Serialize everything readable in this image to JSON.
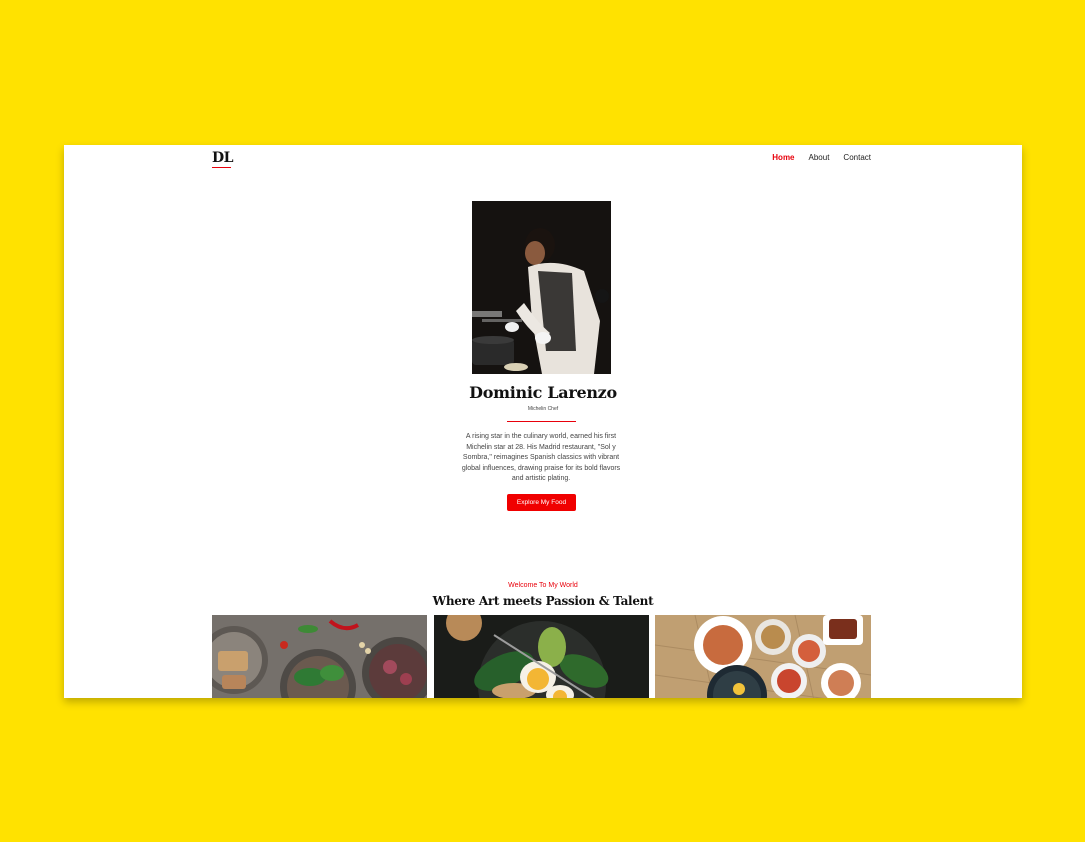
{
  "nav": {
    "logo": "DL",
    "links": [
      "Home",
      "About",
      "Contact"
    ],
    "active": "Home"
  },
  "hero": {
    "name": "Dominic Larenzo",
    "role": "Michelin Chef",
    "bio": "A rising star in the culinary world, earned his first Michelin star at 28. His Madrid restaurant, \"Sol y Sombra,\" reimagines Spanish classics with vibrant global influences, drawing praise for its bold flavors and artistic plating.",
    "cta": "Explore My Food"
  },
  "section": {
    "eyebrow": "Welcome To My World",
    "title": "Where Art meets Passion & Talent"
  },
  "colors": {
    "background": "#FFE200",
    "accent": "#E8000B",
    "button": "#F00000"
  }
}
